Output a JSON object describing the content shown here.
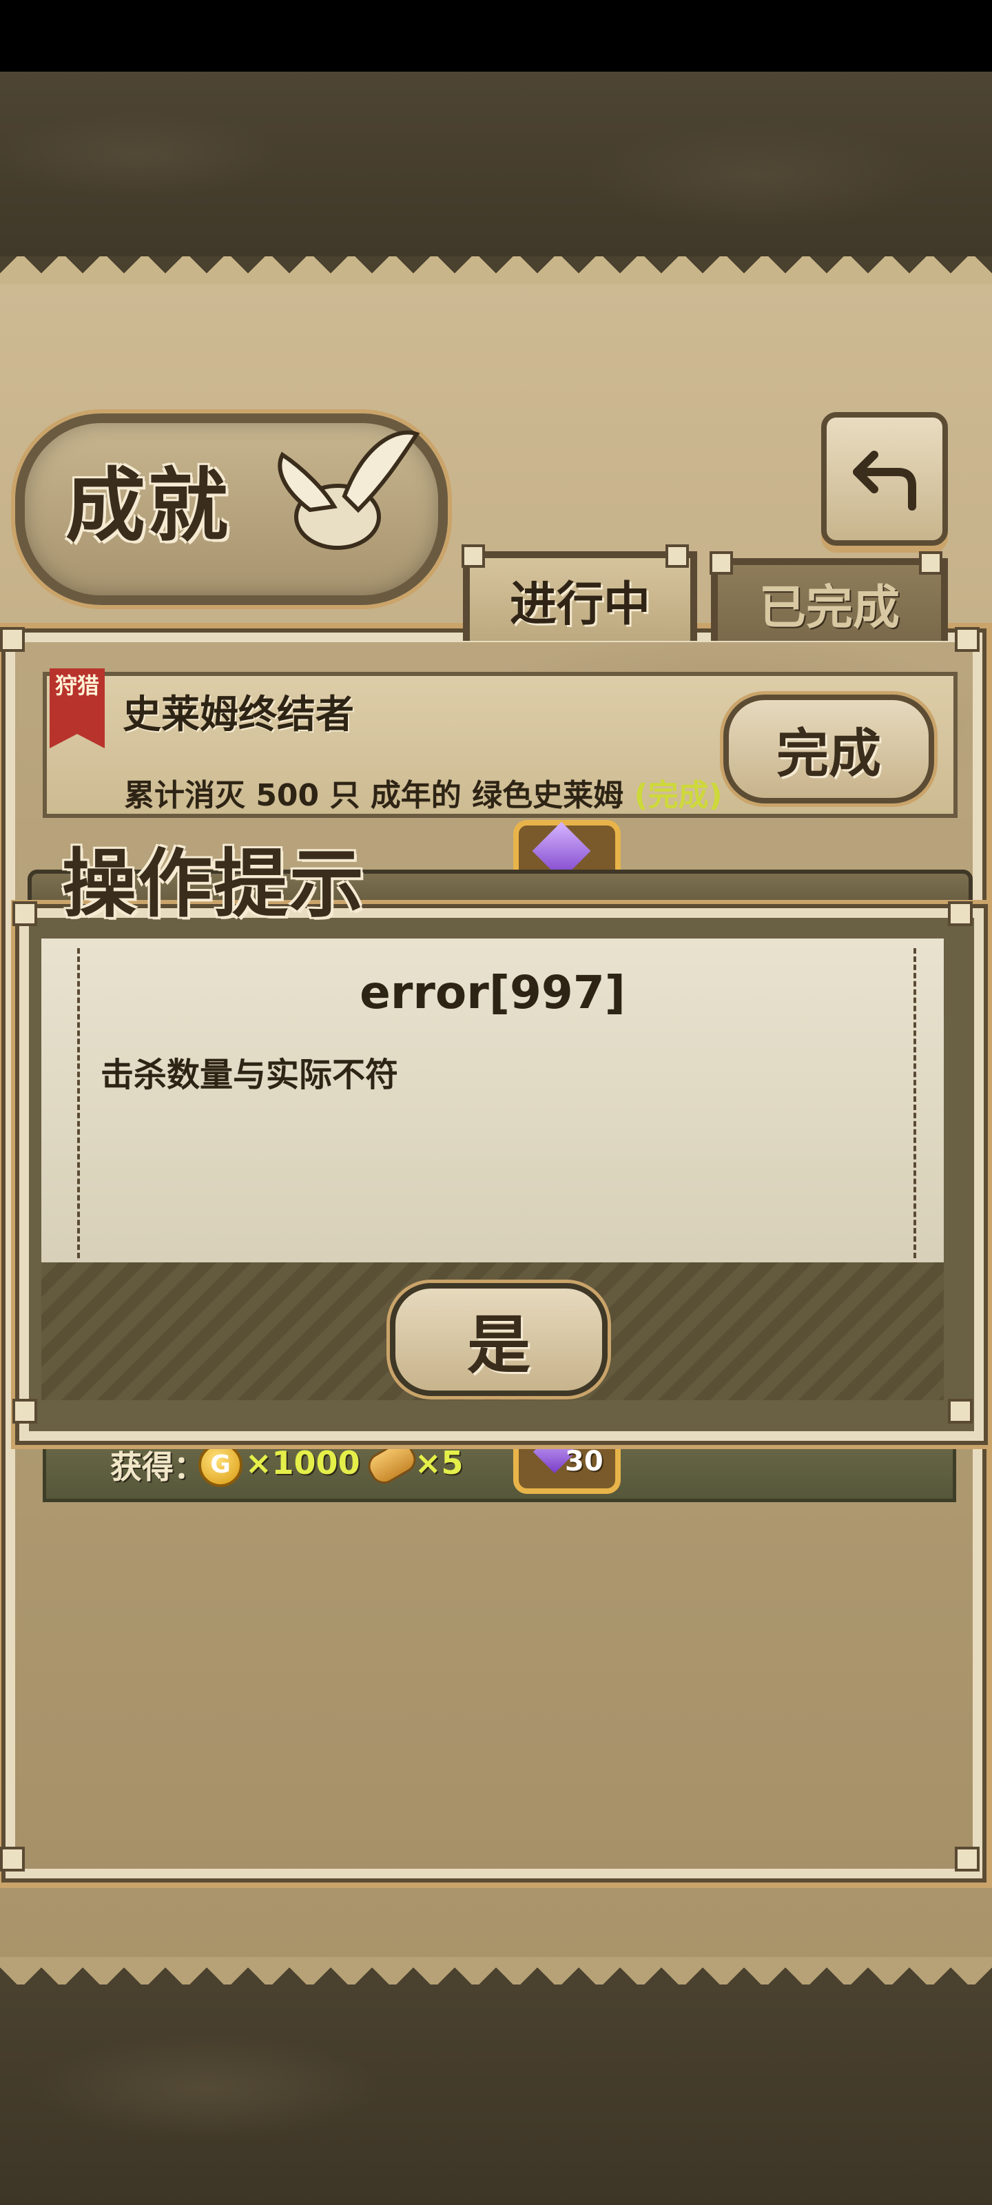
{
  "screen": {
    "title": "成就",
    "back_icon": "back-arrow-icon"
  },
  "tabs": [
    {
      "label": "进行中",
      "active": true
    },
    {
      "label": "已完成",
      "active": false
    }
  ],
  "achievement": {
    "category": "狩猎",
    "name": "史莱姆终结者",
    "description": "累计消灭 500 只 成年的 绿色史莱姆",
    "status": "(完成)",
    "complete_label": "完成",
    "reward_label": "获得：",
    "rewards": [
      {
        "icon": "gold-coin-icon",
        "glyph": "G",
        "amount": "×1000"
      },
      {
        "icon": "bread-icon",
        "amount": "×5"
      },
      {
        "icon": "purple-gem-icon",
        "amount": "30"
      }
    ]
  },
  "dialog": {
    "title": "操作提示",
    "error_code": "error[997]",
    "message": "击杀数量与实际不符",
    "confirm_label": "是"
  },
  "colors": {
    "parchment": "#cdb992",
    "frame": "#5c4c34",
    "highlight": "#e4ef4a",
    "banner_red": "#b8332c",
    "gem": "#7a3ec8"
  }
}
